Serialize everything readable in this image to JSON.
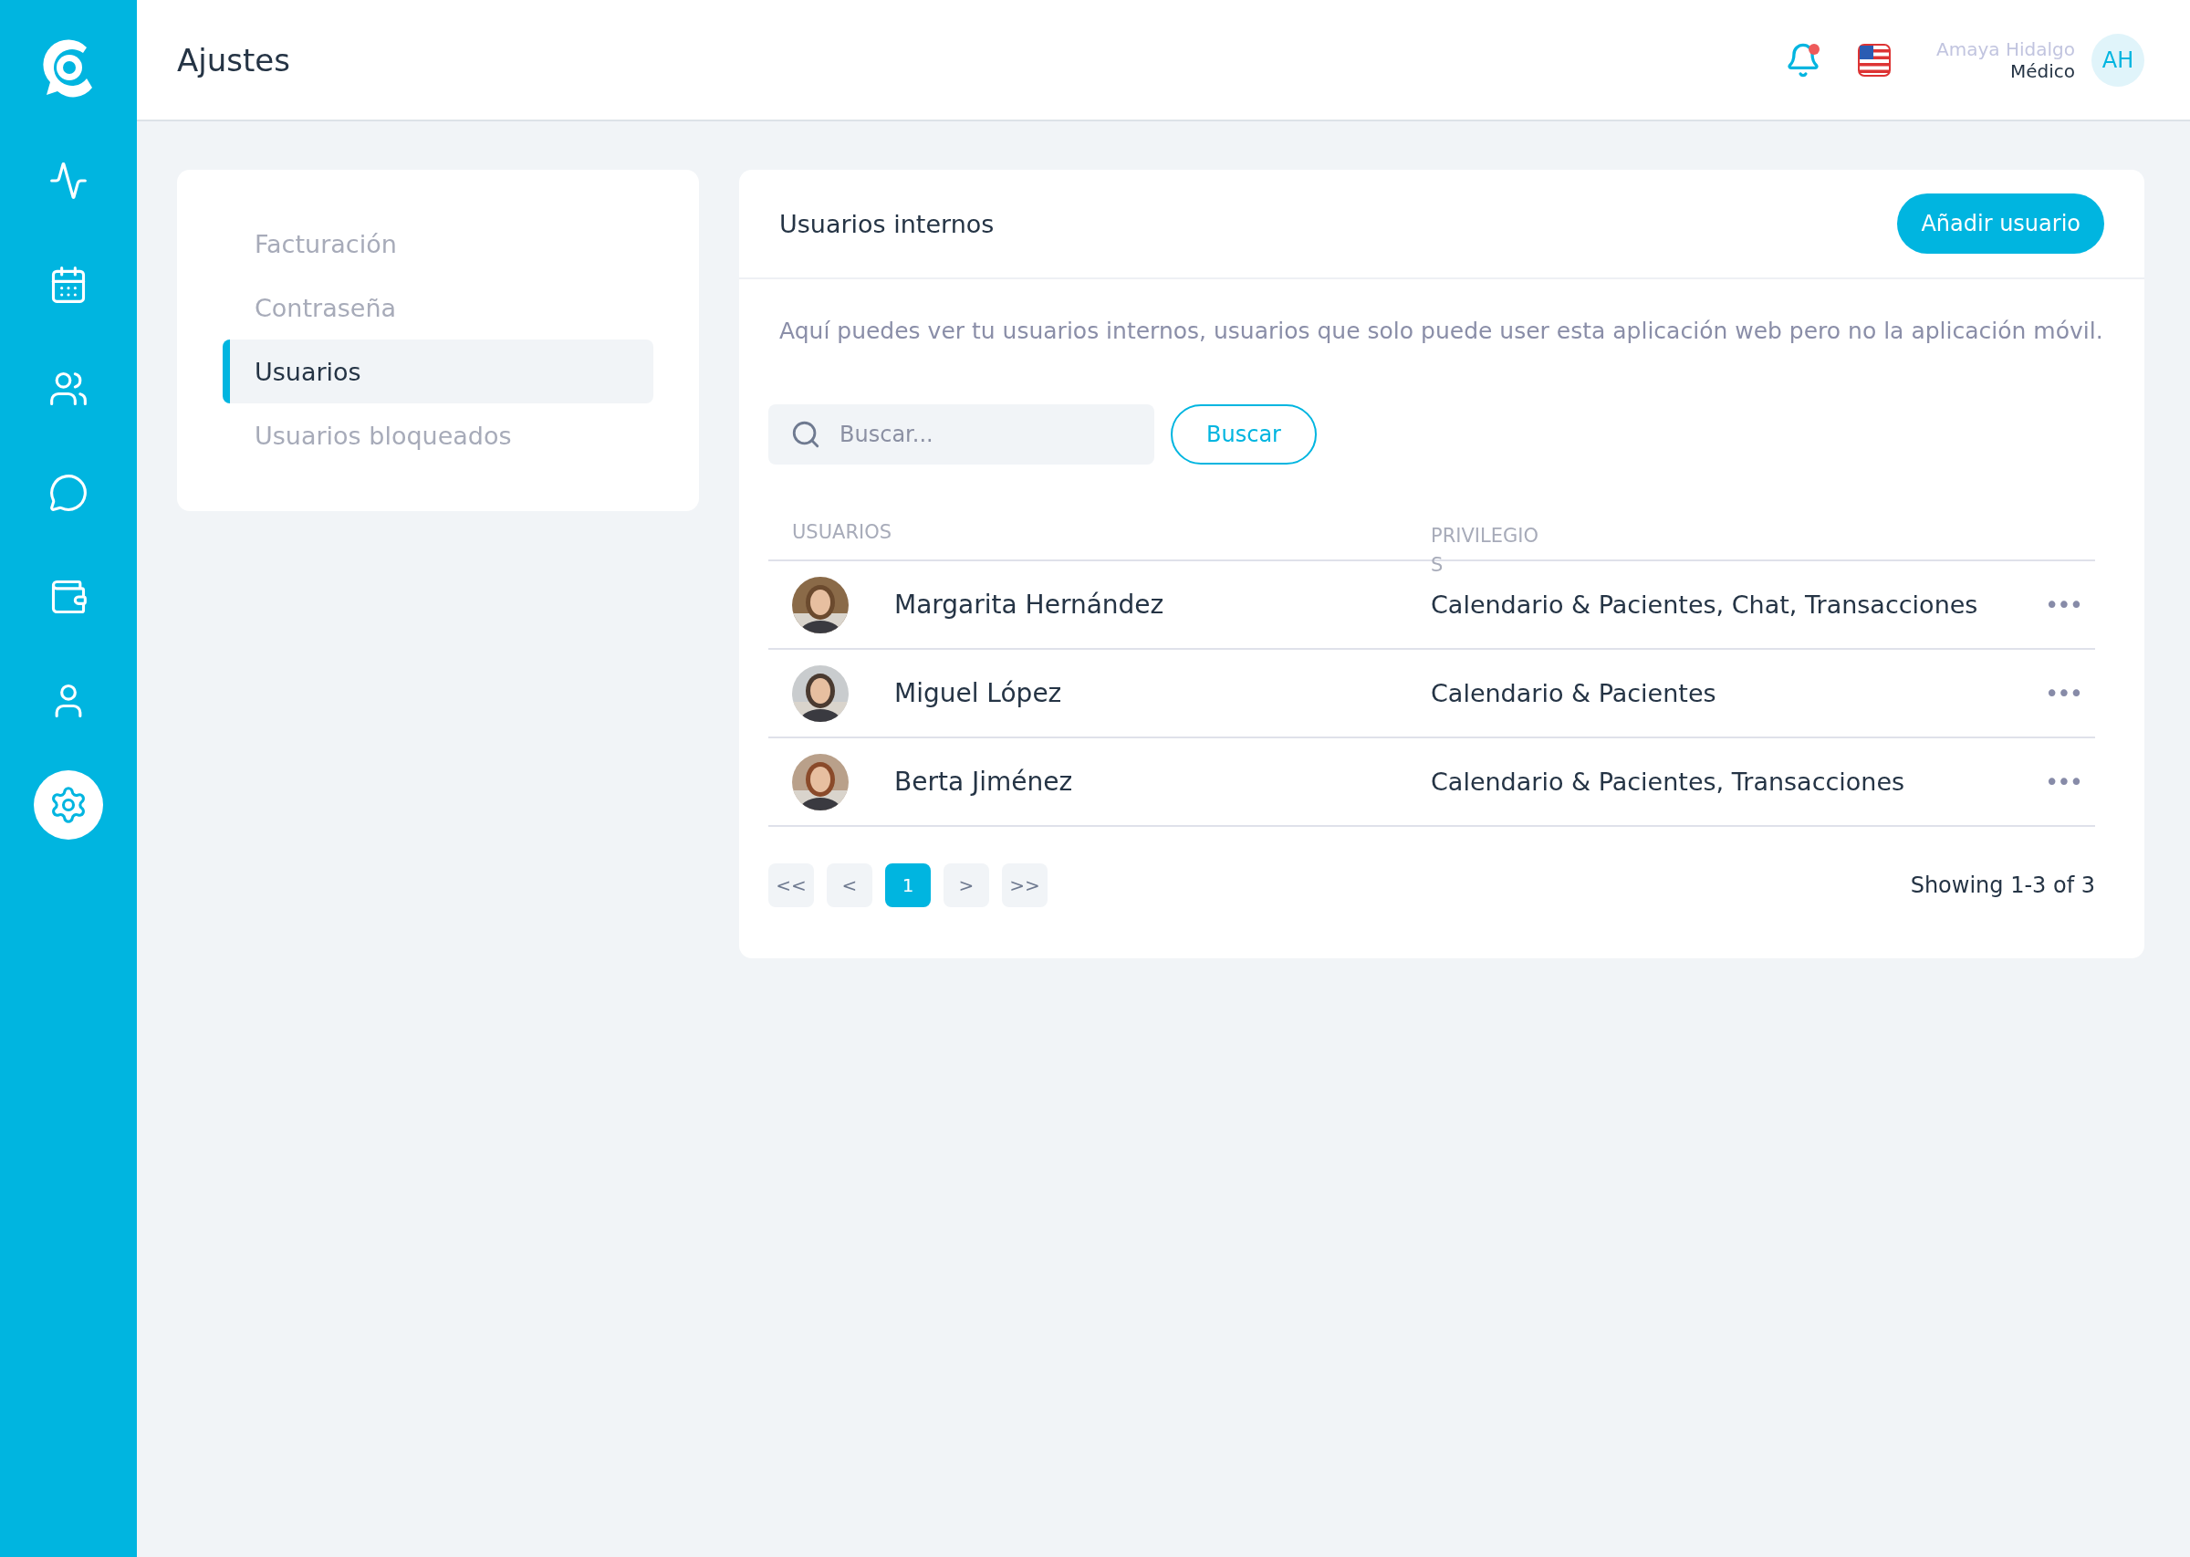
{
  "header": {
    "title": "Ajustes",
    "user": {
      "name": "Amaya Hidalgo",
      "role": "Médico",
      "initials": "AH"
    },
    "notification": {
      "unread": true
    }
  },
  "sidebar": {
    "items": [
      {
        "kind": "activity",
        "selected": false
      },
      {
        "kind": "calendar",
        "selected": false
      },
      {
        "kind": "users",
        "selected": false
      },
      {
        "kind": "chat",
        "selected": false
      },
      {
        "kind": "wallet",
        "selected": false
      },
      {
        "kind": "profile",
        "selected": false
      },
      {
        "kind": "settings",
        "selected": true
      }
    ]
  },
  "settings_nav": {
    "items": [
      {
        "label": "Facturación",
        "selected": false
      },
      {
        "label": "Contraseña",
        "selected": false
      },
      {
        "label": "Usuarios",
        "selected": true
      },
      {
        "label": "Usuarios bloqueados",
        "selected": false
      }
    ]
  },
  "panel": {
    "title": "Usuarios internos",
    "add_button": "Añadir usuario",
    "description": "Aquí puedes ver tu usuarios internos, usuarios que solo puede user esta aplicación web pero no la aplicación móvil.",
    "search": {
      "placeholder": "Buscar...",
      "button": "Buscar"
    },
    "table": {
      "columns": [
        "USUARIOS",
        "PRIVILEGIOS"
      ],
      "rows": [
        {
          "name": "Margarita Hernández",
          "privileges": "Calendario & Pacientes, Chat, Transacciones",
          "more": "•••"
        },
        {
          "name": "Miguel López",
          "privileges": "Calendario & Pacientes",
          "more": "•••"
        },
        {
          "name": "Berta Jiménez",
          "privileges": "Calendario & Pacientes, Transacciones",
          "more": "•••"
        }
      ]
    },
    "pagination": {
      "first": "<<",
      "prev": "<",
      "pages": [
        {
          "label": "1",
          "selected": true
        }
      ],
      "next": ">",
      "last": ">>",
      "summary": "Showing 1-3 of 3"
    }
  }
}
